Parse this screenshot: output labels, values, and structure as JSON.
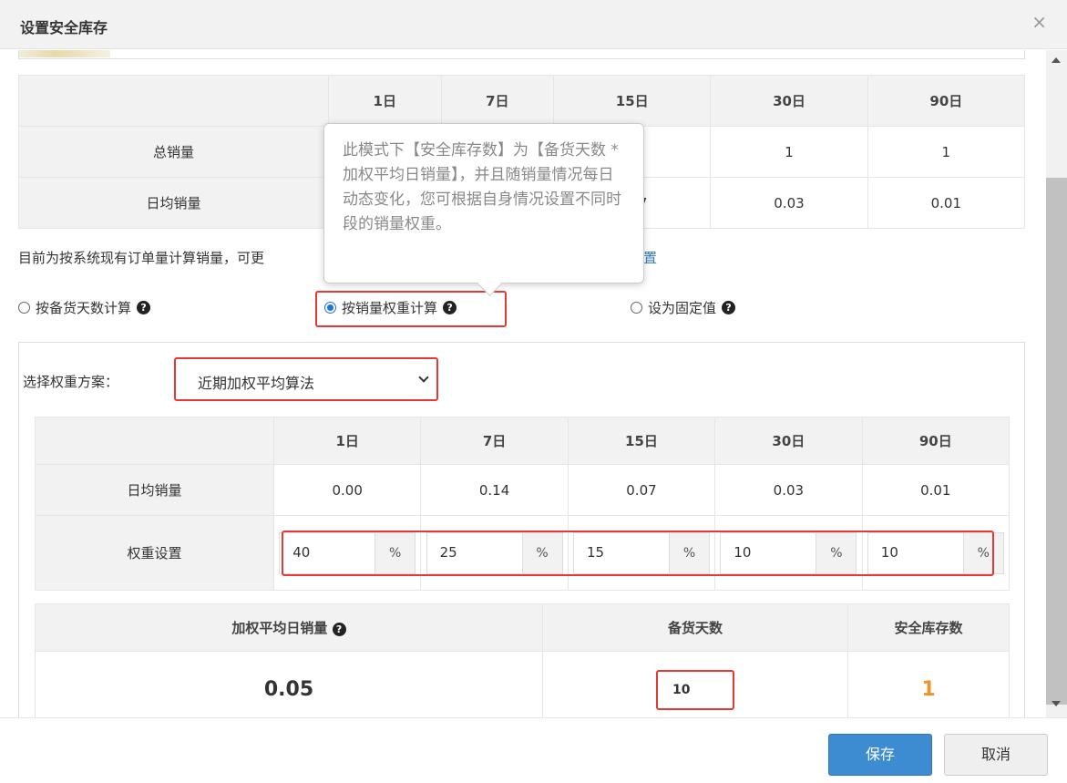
{
  "dialog": {
    "title": "设置安全库存",
    "close_glyph": "×"
  },
  "sales_table": {
    "headers": [
      "",
      "1日",
      "7日",
      "15日",
      "30日",
      "90日"
    ],
    "rows": [
      {
        "label": "总销量",
        "values": [
          "",
          "",
          "1",
          "1",
          "1"
        ]
      },
      {
        "label": "日均销量",
        "values": [
          "",
          "",
          "0.07",
          "0.03",
          "0.01"
        ]
      }
    ]
  },
  "note": {
    "text": "目前为按系统现有订单量计算销量，可更",
    "link_fragment": "置"
  },
  "tooltip": {
    "text": "此模式下【安全库存数】为【备货天数 * 加权平均日销量】，并且随销量情况每日动态变化，您可根据自身情况设置不同时段的销量权重。"
  },
  "modes": [
    {
      "label": "按备货天数计算",
      "checked": false
    },
    {
      "label": "按销量权重计算",
      "checked": true
    },
    {
      "label": "设为固定值",
      "checked": false
    }
  ],
  "scheme": {
    "label": "选择权重方案：",
    "selected": "近期加权平均算法"
  },
  "weight_table": {
    "headers": [
      "",
      "1日",
      "7日",
      "15日",
      "30日",
      "90日"
    ],
    "daily_label": "日均销量",
    "daily_values": [
      "0.00",
      "0.14",
      "0.07",
      "0.03",
      "0.01"
    ],
    "weight_label": "权重设置",
    "weights": [
      "40",
      "25",
      "15",
      "10",
      "10"
    ],
    "unit": "%"
  },
  "result": {
    "weighted_label": "加权平均日销量",
    "days_label": "备货天数",
    "safety_label": "安全库存数",
    "weighted_value": "0.05",
    "days_value": "10",
    "safety_value": "1"
  },
  "footer": {
    "save": "保存",
    "cancel": "取消"
  },
  "colors": {
    "primary": "#3d8bd1",
    "highlight": "#e53935",
    "safety_value": "#f0932b"
  }
}
